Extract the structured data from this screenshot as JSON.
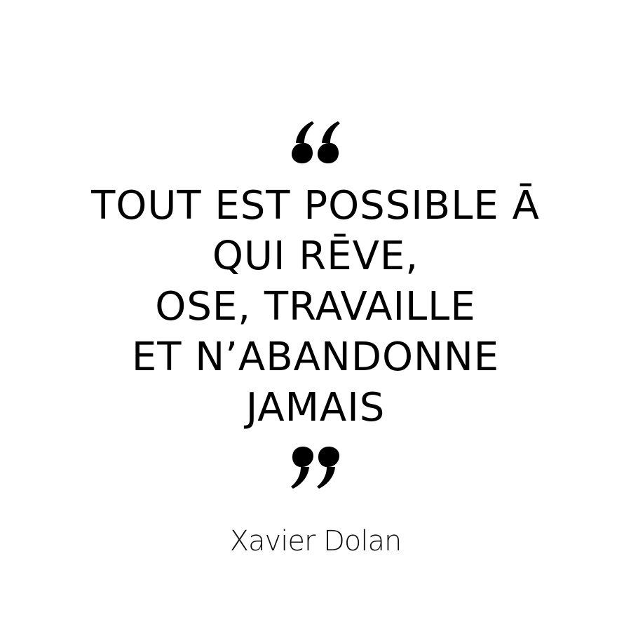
{
  "quote": {
    "lines": [
      "TOUT EST POSSIBLE Ā",
      "QUI RĒVE,",
      "OSE, TRAVAILLE",
      "ET N’ABANDONNE",
      "JAMAIS"
    ],
    "author": "Xavier Dolan"
  },
  "icons": {
    "open": "opening-quote-mark-icon",
    "close": "closing-quote-mark-icon"
  },
  "colors": {
    "background": "#ffffff",
    "text": "#000000"
  }
}
